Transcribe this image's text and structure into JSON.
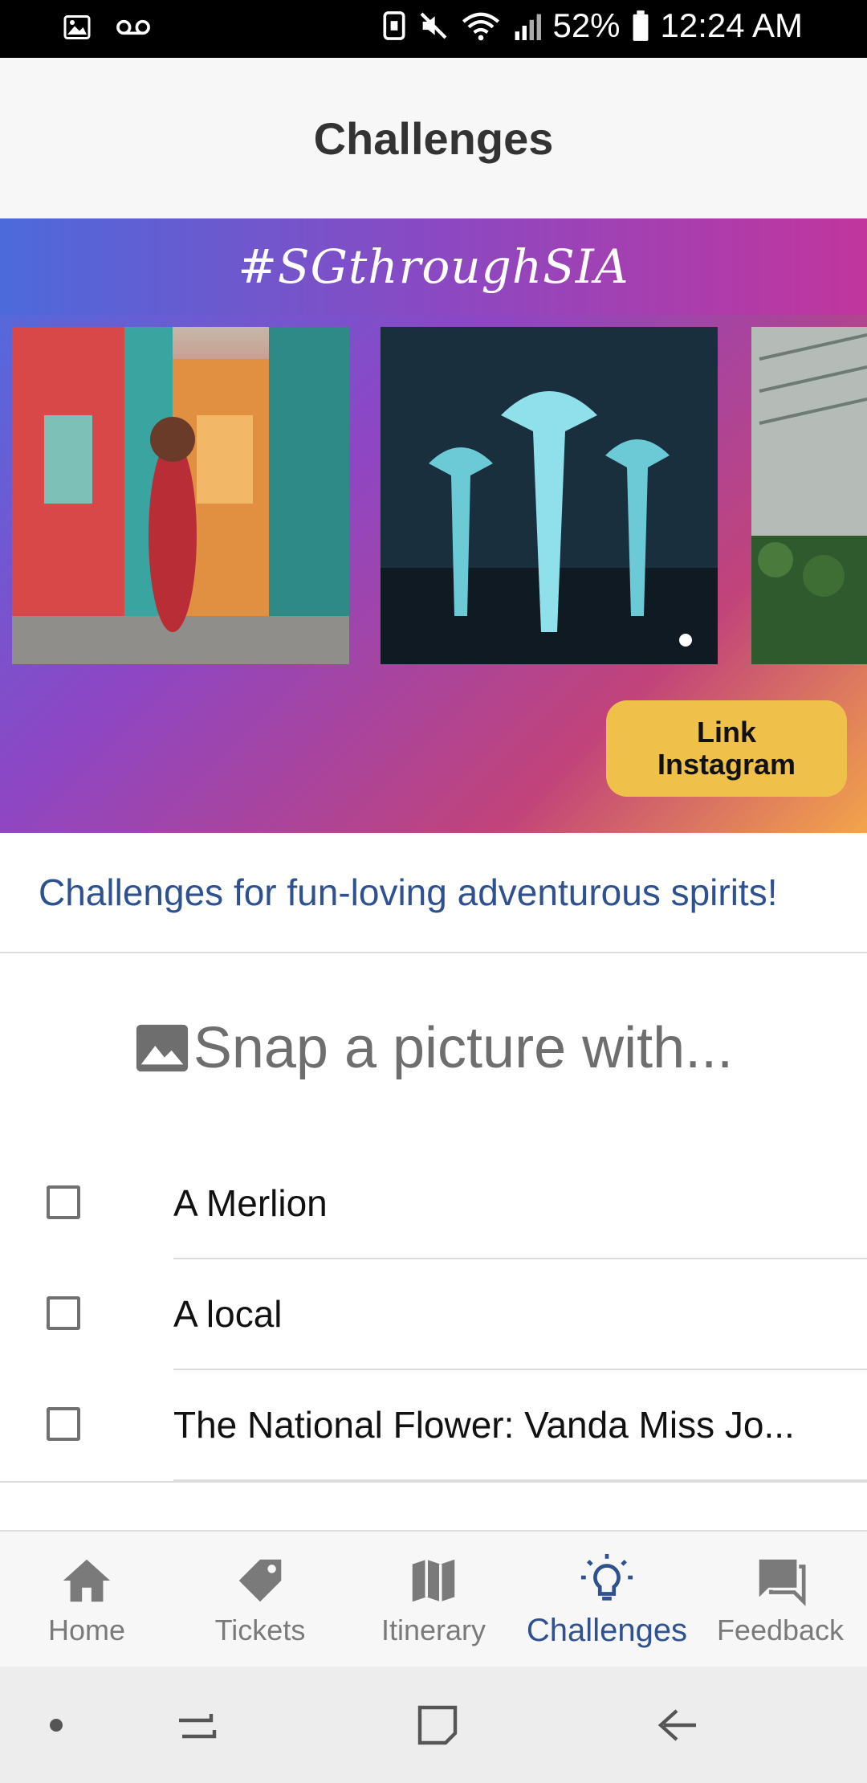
{
  "status_bar": {
    "battery": "52%",
    "time": "12:24 AM"
  },
  "header": {
    "title": "Challenges"
  },
  "banner": {
    "hashtag": "#SGthroughSIA",
    "link_instagram_label": "Link\nInstagram",
    "accent_color": "#efc04a"
  },
  "main": {
    "subtitle": "Challenges for fun-loving adventurous spirits!",
    "snap_heading": "Snap a picture with...",
    "checklist": [
      {
        "label": "A Merlion",
        "checked": false
      },
      {
        "label": "A local",
        "checked": false
      },
      {
        "label": "The National Flower: Vanda Miss Jo...",
        "checked": false
      }
    ]
  },
  "tab_bar": {
    "tabs": [
      {
        "label": "Home",
        "icon": "home-icon",
        "active": false
      },
      {
        "label": "Tickets",
        "icon": "tag-icon",
        "active": false
      },
      {
        "label": "Itinerary",
        "icon": "map-icon",
        "active": false
      },
      {
        "label": "Challenges",
        "icon": "lightbulb-icon",
        "active": true
      },
      {
        "label": "Feedback",
        "icon": "chat-icon",
        "active": false
      }
    ],
    "active_color": "#2f5190",
    "inactive_color": "#7a7a7a"
  }
}
